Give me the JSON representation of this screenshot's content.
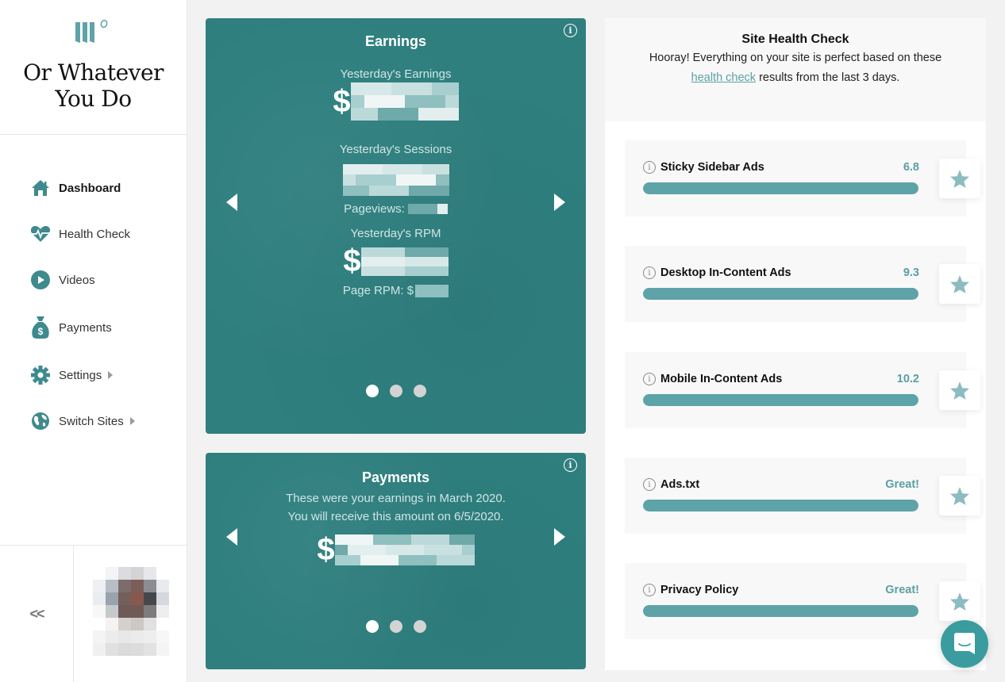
{
  "brand": {
    "name_line1": "Or Whatever",
    "name_line2": "You Do",
    "accent": "#5ea3a8"
  },
  "sidebar": {
    "items": [
      {
        "label": "Dashboard",
        "icon": "home-icon",
        "active": true
      },
      {
        "label": "Health Check",
        "icon": "heartbeat-icon"
      },
      {
        "label": "Videos",
        "icon": "play-circle-icon"
      },
      {
        "label": "Payments",
        "icon": "money-bag-icon"
      },
      {
        "label": "Settings",
        "icon": "gear-icon",
        "submenu": true
      },
      {
        "label": "Switch Sites",
        "icon": "globe-icon",
        "submenu": true
      }
    ],
    "collapse_label": "<<"
  },
  "earnings": {
    "title": "Earnings",
    "yesterday_earnings_label": "Yesterday's Earnings",
    "currency_symbol": "$",
    "yesterday_sessions_label": "Yesterday's Sessions",
    "pageviews_label": "Pageviews:",
    "yesterday_rpm_label": "Yesterday's RPM",
    "page_rpm_label": "Page RPM: $",
    "values_redacted": true,
    "slide_count": 3,
    "active_slide": 1
  },
  "payments": {
    "title": "Payments",
    "line1": "These were your earnings in March 2020.",
    "line2": "You will receive this amount on 6/5/2020.",
    "currency_symbol": "$",
    "amount_redacted": true,
    "slide_count": 3,
    "active_slide": 1
  },
  "health": {
    "title": "Site Health Check",
    "desc_line1": "Hooray! Everything on your site is perfect based on these",
    "link_text": "health check",
    "desc_line2_rest": " results from the last 3 days.",
    "checks": [
      {
        "label": "Sticky Sidebar Ads",
        "score": "6.8",
        "progress": 1.0
      },
      {
        "label": "Desktop In-Content Ads",
        "score": "9.3",
        "progress": 1.0
      },
      {
        "label": "Mobile In-Content Ads",
        "score": "10.2",
        "progress": 1.0
      },
      {
        "label": "Ads.txt",
        "score": "Great!",
        "progress": 1.0
      },
      {
        "label": "Privacy Policy",
        "score": "Great!",
        "progress": 1.0
      }
    ]
  },
  "info_glyph": "i"
}
